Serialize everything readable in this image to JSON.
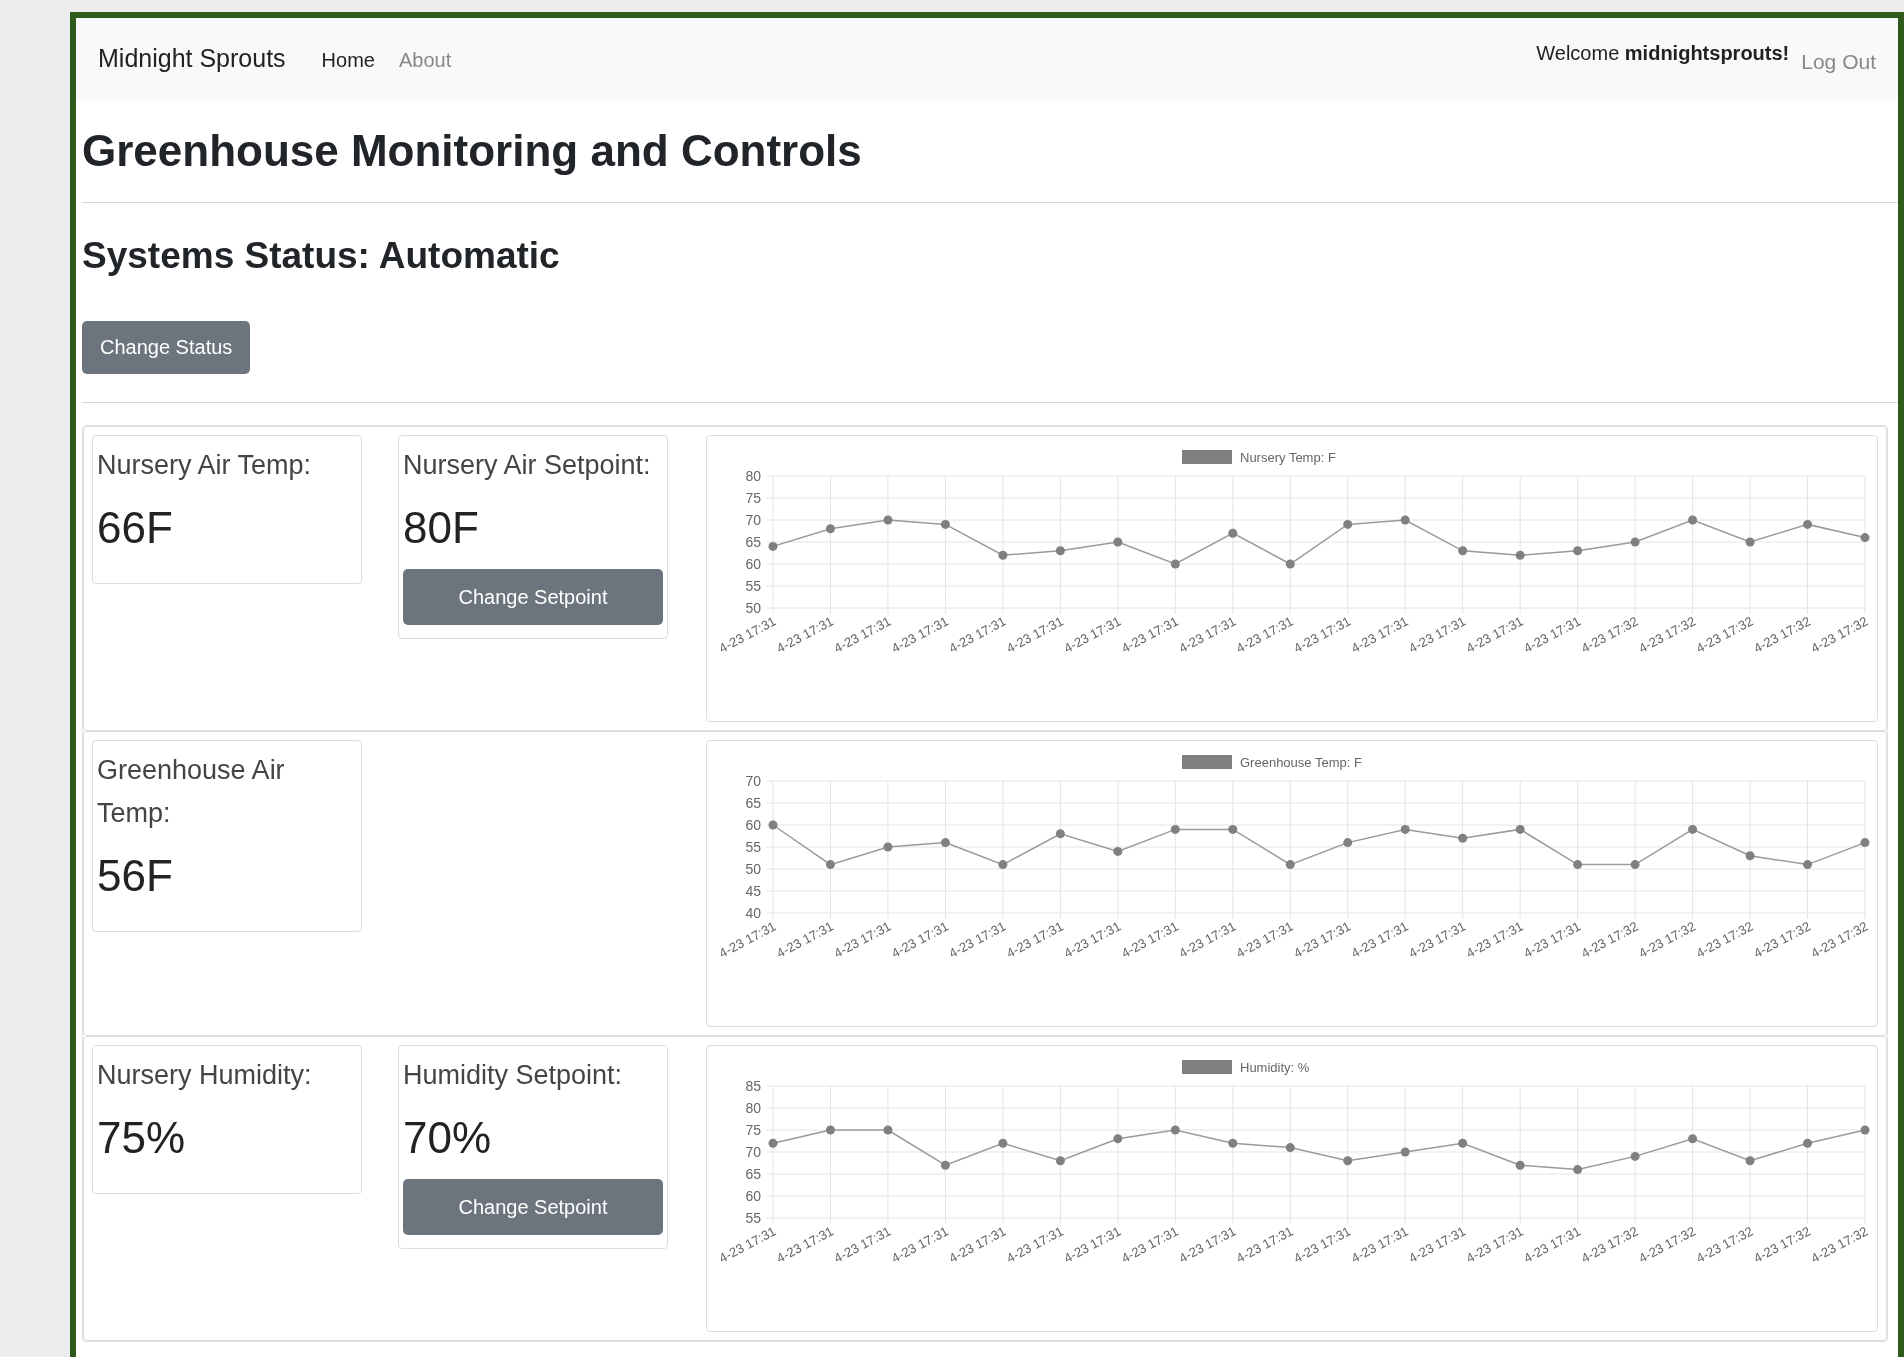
{
  "navbar": {
    "brand": "Midnight Sprouts",
    "links": [
      {
        "label": "Home",
        "selected": true
      },
      {
        "label": "About",
        "selected": false
      }
    ],
    "welcome": "Welcome **midnightsprouts!**",
    "logout": "Log Out"
  },
  "title": "Greenhouse Monitoring and Controls",
  "status_heading": "Systems Status: Automatic",
  "status_button": "Change Status",
  "panels": [
    {
      "readings": [
        {
          "kind": "reading",
          "label": "Nursery Air Temp:",
          "value": "66F"
        },
        {
          "kind": "setpoint",
          "label": "Nursery Air Setpoint:",
          "value": "80F",
          "button": "Change Setpoint"
        }
      ],
      "chart_data": {
        "type": "line",
        "categories": [
          "4-23 17:31",
          "4-23 17:31",
          "4-23 17:31",
          "4-23 17:31",
          "4-23 17:31",
          "4-23 17:31",
          "4-23 17:31",
          "4-23 17:31",
          "4-23 17:31",
          "4-23 17:31",
          "4-23 17:31",
          "4-23 17:31",
          "4-23 17:31",
          "4-23 17:31",
          "4-23 17:31",
          "4-23 17:32",
          "4-23 17:32",
          "4-23 17:32",
          "4-23 17:32",
          "4-23 17:32"
        ],
        "grid": true,
        "series": [
          {
            "name": "Nursery Temp: F",
            "color": "#808080",
            "marker": "circle",
            "values": [
              64,
              68,
              70,
              69,
              62,
              63,
              65,
              60,
              67,
              60,
              69,
              70,
              63,
              62,
              63,
              65,
              70,
              65,
              69,
              66
            ]
          }
        ],
        "ylim": [
          50,
          80
        ],
        "yticks": [
          50,
          55,
          60,
          65,
          70,
          75,
          80
        ]
      }
    },
    {
      "readings": [
        {
          "kind": "reading",
          "label": "Greenhouse Air Temp:",
          "value": "56F"
        }
      ],
      "chart_data": {
        "type": "line",
        "categories": [
          "4-23 17:31",
          "4-23 17:31",
          "4-23 17:31",
          "4-23 17:31",
          "4-23 17:31",
          "4-23 17:31",
          "4-23 17:31",
          "4-23 17:31",
          "4-23 17:31",
          "4-23 17:31",
          "4-23 17:31",
          "4-23 17:31",
          "4-23 17:31",
          "4-23 17:31",
          "4-23 17:31",
          "4-23 17:32",
          "4-23 17:32",
          "4-23 17:32",
          "4-23 17:32",
          "4-23 17:32"
        ],
        "grid": true,
        "series": [
          {
            "name": "Greenhouse Temp: F",
            "color": "#808080",
            "marker": "circle",
            "values": [
              60,
              51,
              55,
              56,
              51,
              58,
              54,
              59,
              59,
              51,
              56,
              59,
              57,
              59,
              51,
              51,
              59,
              53,
              51,
              56
            ]
          }
        ],
        "ylim": [
          40,
          70
        ],
        "yticks": [
          40,
          45,
          50,
          55,
          60,
          65,
          70
        ]
      }
    },
    {
      "readings": [
        {
          "kind": "reading",
          "label": "Nursery Humidity:",
          "value": "75%"
        },
        {
          "kind": "setpoint",
          "label": "Humidity Setpoint:",
          "value": "70%",
          "button": "Change Setpoint"
        }
      ],
      "chart_data": {
        "type": "line",
        "categories": [
          "4-23 17:31",
          "4-23 17:31",
          "4-23 17:31",
          "4-23 17:31",
          "4-23 17:31",
          "4-23 17:31",
          "4-23 17:31",
          "4-23 17:31",
          "4-23 17:31",
          "4-23 17:31",
          "4-23 17:31",
          "4-23 17:31",
          "4-23 17:31",
          "4-23 17:31",
          "4-23 17:31",
          "4-23 17:32",
          "4-23 17:32",
          "4-23 17:32",
          "4-23 17:32",
          "4-23 17:32"
        ],
        "grid": true,
        "series": [
          {
            "name": "Humidity: %",
            "color": "#808080",
            "marker": "circle",
            "values": [
              72,
              75,
              75,
              67,
              72,
              68,
              73,
              75,
              72,
              71,
              68,
              70,
              72,
              67,
              66,
              69,
              73,
              68,
              72,
              75
            ]
          }
        ],
        "ylim": [
          55,
          85
        ],
        "yticks": [
          55,
          60,
          65,
          70,
          75,
          80,
          85
        ]
      }
    }
  ]
}
